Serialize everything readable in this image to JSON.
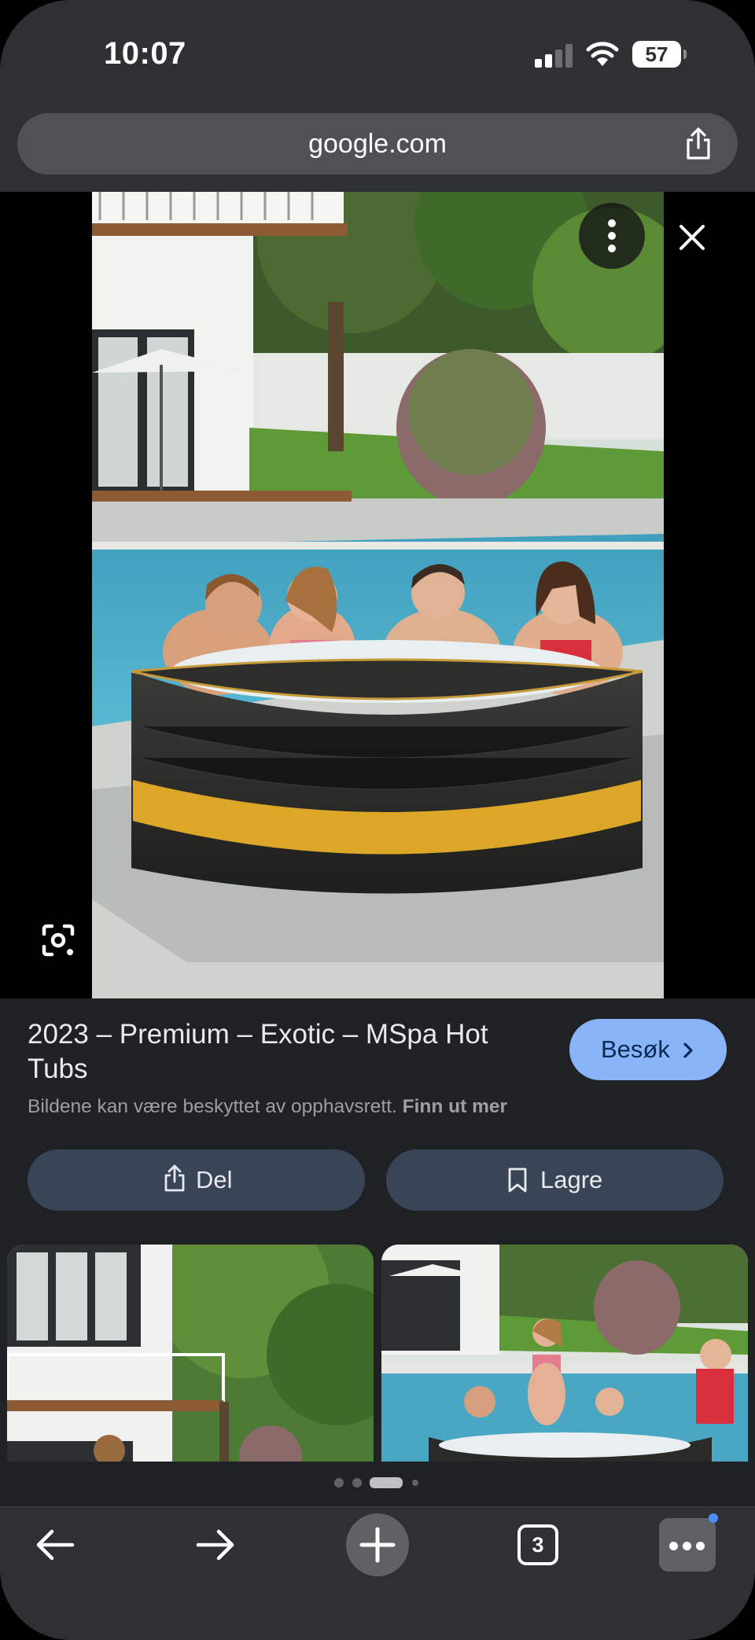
{
  "status_bar": {
    "time": "10:07",
    "battery_level": "57"
  },
  "browser": {
    "url": "google.com"
  },
  "result": {
    "title": "2023 – Premium – Exotic – MSpa Hot Tubs",
    "visit_label": "Besøk",
    "copyright_text": "Bildene kan være beskyttet av opphavsrett.",
    "learn_more": "Finn ut mer",
    "share_label": "Del",
    "save_label": "Lagre"
  },
  "carousel": {
    "page_count": 4,
    "active_index": 2
  },
  "toolbar": {
    "tab_count": "3"
  },
  "colors": {
    "accent_button": "#8ab4f8",
    "action_button": "#394457",
    "background": "#202124",
    "tub_gold": "#dca628"
  }
}
